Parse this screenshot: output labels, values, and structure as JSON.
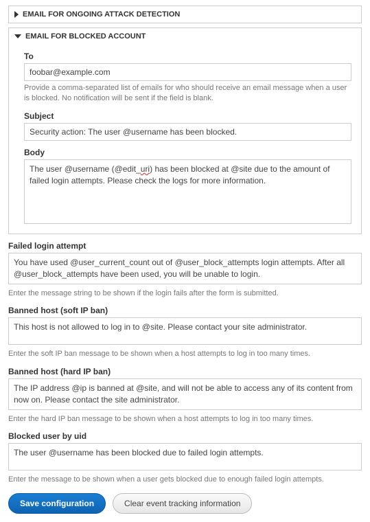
{
  "panels": {
    "ongoing": {
      "title": "EMAIL FOR ONGOING ATTACK DETECTION"
    },
    "blocked": {
      "title": "EMAIL FOR BLOCKED ACCOUNT",
      "to_label": "To",
      "to_value": "foobar@example.com",
      "to_hint": "Provide a comma-separated list of emails for who should receive an email message when a user is blocked. No notification will be sent if the field is blank.",
      "subject_label": "Subject",
      "subject_value": "Security action: The user @username has been blocked.",
      "body_label": "Body",
      "body_pre": "The user @username (@edit_",
      "body_spell": "uri",
      "body_post": ") has been blocked at @site due to the amount of failed login attempts. Please check the logs for more information."
    }
  },
  "failed_login": {
    "label": "Failed login attempt",
    "value": "You have used @user_current_count out of @user_block_attempts login attempts. After all @user_block_attempts have been used, you will be unable to login.",
    "hint": "Enter the message string to be shown if the login fails after the form is submitted."
  },
  "soft_ban": {
    "label": "Banned host (soft IP ban)",
    "value": "This host is not allowed to log in to @site. Please contact your site administrator.",
    "hint": "Enter the soft IP ban message to be shown when a host attempts to log in too many times."
  },
  "hard_ban": {
    "label": "Banned host (hard IP ban)",
    "value": "The IP address @ip is banned at @site, and will not be able to access any of its content from now on. Please contact the site administrator.",
    "hint": "Enter the hard IP ban message to be shown when a host attempts to log in too many times."
  },
  "blocked_uid": {
    "label": "Blocked user by uid",
    "value": "The user @username has been blocked due to failed login attempts.",
    "hint": "Enter the message to be shown when a user gets blocked due to enough failed login attempts."
  },
  "buttons": {
    "save": "Save configuration",
    "clear": "Clear event tracking information"
  }
}
